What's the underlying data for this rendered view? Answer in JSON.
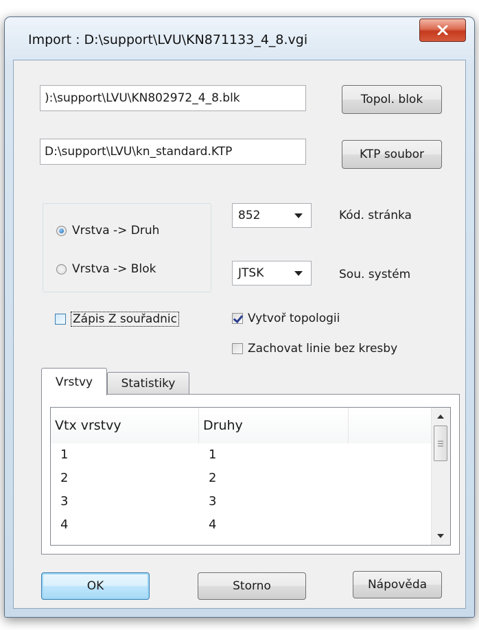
{
  "window": {
    "title": "Import : D:\\support\\LVU\\KN871133_4_8.vgi"
  },
  "fields": {
    "blk_path": "):\\support\\LVU\\KN802972_4_8.blk",
    "ktp_path": "D:\\support\\LVU\\kn_standard.KTP"
  },
  "buttons": {
    "topol_blok": "Topol. blok",
    "ktp_soubor": "KTP soubor",
    "ok": "OK",
    "storno": "Storno",
    "napoveda": "Nápověda"
  },
  "radios": [
    {
      "label": "Vrstva -> Druh",
      "checked": true
    },
    {
      "label": "Vrstva -> Blok",
      "checked": false
    }
  ],
  "combos": {
    "code_page": {
      "value": "852",
      "label": "Kód. stránka"
    },
    "coord_system": {
      "value": "JTSK",
      "label": "Sou. systém"
    }
  },
  "checkboxes": {
    "zapis_z": {
      "label": "Zápis Z souřadnic",
      "checked": false
    },
    "vytvor_topologii": {
      "label": "Vytvoř topologii",
      "checked": true
    },
    "zachovat_linie": {
      "label": "Zachovat linie bez kresby",
      "checked": false
    }
  },
  "tabs": [
    {
      "label": "Vrstvy",
      "active": true
    },
    {
      "label": "Statistiky",
      "active": false
    }
  ],
  "list": {
    "columns": [
      "Vtx vrstvy",
      "Druhy",
      ""
    ],
    "rows": [
      [
        "1",
        "1"
      ],
      [
        "2",
        "2"
      ],
      [
        "3",
        "3"
      ],
      [
        "4",
        "4"
      ]
    ]
  },
  "icons": {
    "close": "close-icon",
    "scroll_up": "scroll-up-icon",
    "scroll_down": "scroll-down-icon",
    "dropdown": "chevron-down-icon"
  }
}
